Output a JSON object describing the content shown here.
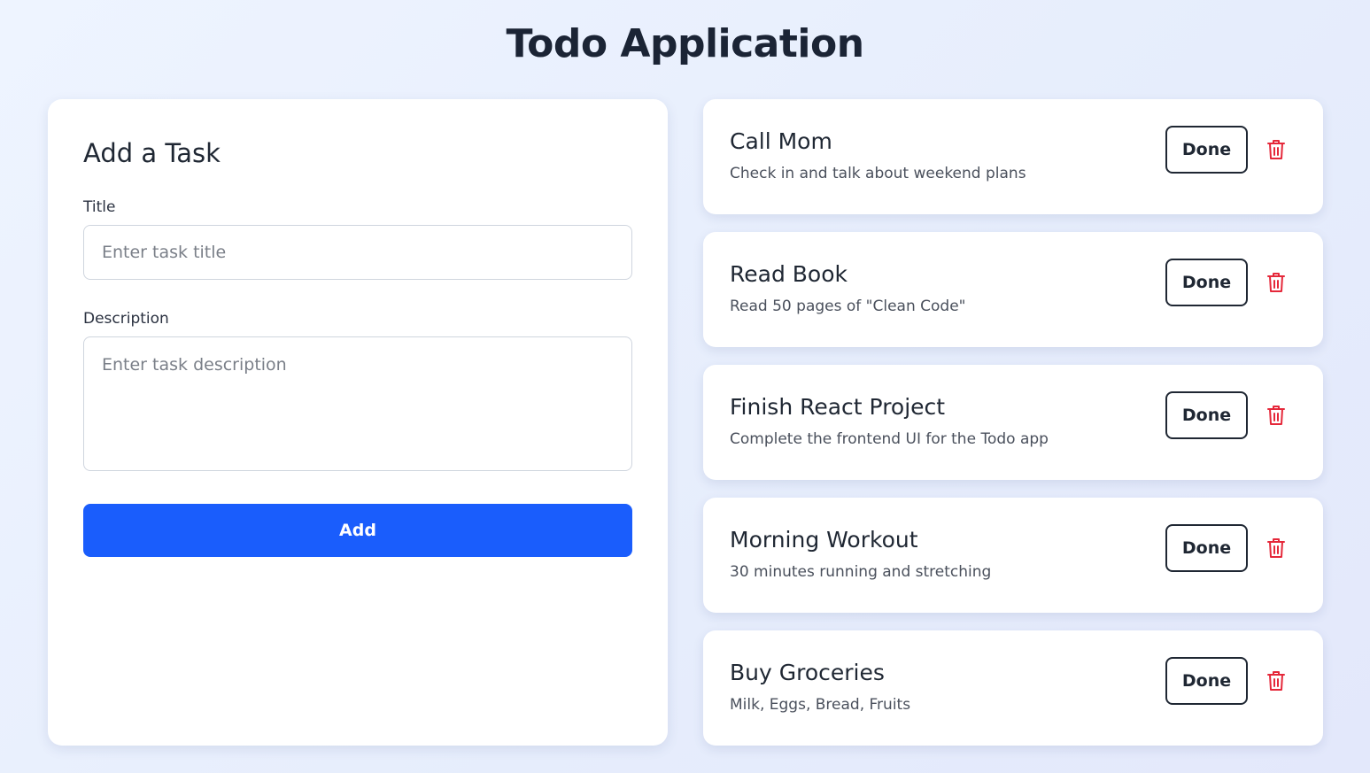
{
  "page": {
    "title": "Todo Application"
  },
  "form": {
    "heading": "Add a Task",
    "title_label": "Title",
    "title_placeholder": "Enter task title",
    "title_value": "",
    "description_label": "Description",
    "description_placeholder": "Enter task description",
    "description_value": "",
    "add_label": "Add"
  },
  "tasks": [
    {
      "title": "Call Mom",
      "description": "Check in and talk about weekend plans",
      "done_label": "Done",
      "delete_icon": "trash-icon"
    },
    {
      "title": "Read Book",
      "description": "Read 50 pages of \"Clean Code\"",
      "done_label": "Done",
      "delete_icon": "trash-icon"
    },
    {
      "title": "Finish React Project",
      "description": "Complete the frontend UI for the Todo app",
      "done_label": "Done",
      "delete_icon": "trash-icon"
    },
    {
      "title": "Morning Workout",
      "description": "30 minutes running and stretching",
      "done_label": "Done",
      "delete_icon": "trash-icon"
    },
    {
      "title": "Buy Groceries",
      "description": "Milk, Eggs, Bread, Fruits",
      "done_label": "Done",
      "delete_icon": "trash-icon"
    }
  ],
  "colors": {
    "primary": "#1a5dfc",
    "danger": "#e5283a",
    "text": "#1f2733",
    "background": "#eaf0fd"
  }
}
